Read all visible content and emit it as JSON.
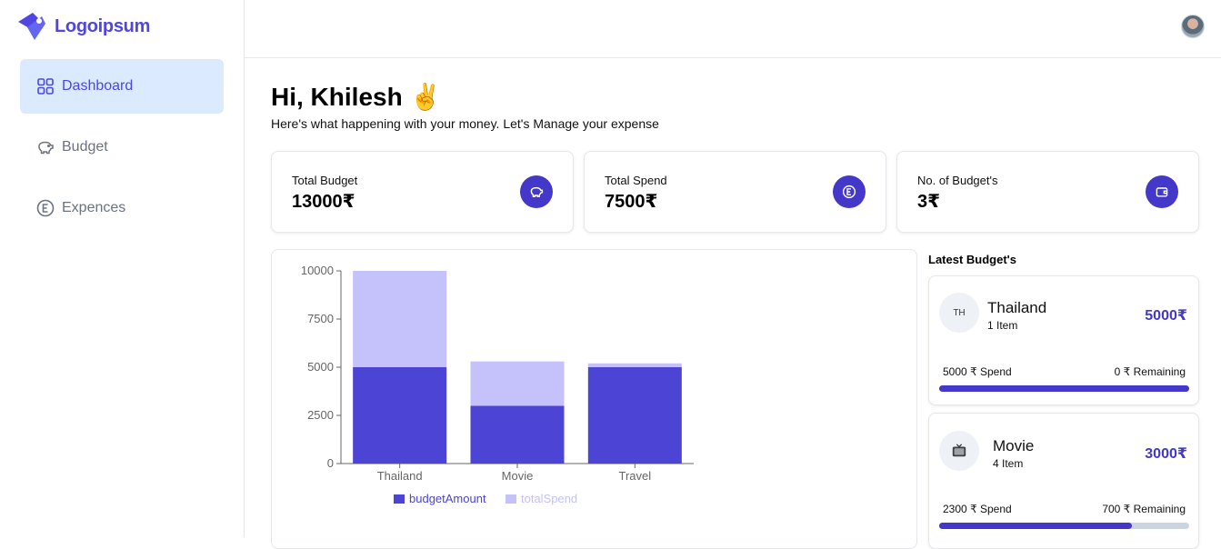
{
  "app": {
    "logo_text": "Logoipsum"
  },
  "sidebar": {
    "items": [
      {
        "label": "Dashboard",
        "icon": "grid-icon",
        "active": true
      },
      {
        "label": "Budget",
        "icon": "piggy-bank-icon",
        "active": false
      },
      {
        "label": "Expences",
        "icon": "euro-circle-icon",
        "active": false
      }
    ]
  },
  "main": {
    "greeting": "Hi, Khilesh ✌️",
    "subtitle": "Here's what happening with your money. Let's Manage your expense"
  },
  "stats": [
    {
      "label": "Total Budget",
      "value": "13000₹",
      "icon": "piggy-bank-icon"
    },
    {
      "label": "Total Spend",
      "value": "7500₹",
      "icon": "euro-circle-icon"
    },
    {
      "label": "No. of Budget's",
      "value": "3₹",
      "icon": "wallet-icon"
    }
  ],
  "colors": {
    "accent": "#4338ca",
    "budget": "#4b44d4",
    "spend": "#c4c1fb"
  },
  "chart_data": {
    "type": "bar",
    "stacked": true,
    "categories": [
      "Thailand",
      "Movie",
      "Travel"
    ],
    "series": [
      {
        "name": "budgetAmount",
        "values": [
          5000,
          3000,
          5000
        ]
      },
      {
        "name": "totalSpend",
        "values": [
          5000,
          2300,
          200
        ]
      }
    ],
    "yticks": [
      "0",
      "2500",
      "5000",
      "7500",
      "10000"
    ],
    "ylim": [
      0,
      10000
    ],
    "legend": "bottom"
  },
  "latest": {
    "title": "Latest Budget's",
    "budgets": [
      {
        "icon_text": "TH",
        "name": "Thailand",
        "items": "1 Item",
        "amount": "5000₹",
        "spend": "5000 ₹ Spend",
        "remaining": "0 ₹ Remaining",
        "progress": 1.0
      },
      {
        "icon_text": "📺",
        "name": "Movie",
        "items": "4 Item",
        "amount": "3000₹",
        "spend": "2300 ₹ Spend",
        "remaining": "700 ₹ Remaining",
        "progress": 0.77
      }
    ]
  }
}
